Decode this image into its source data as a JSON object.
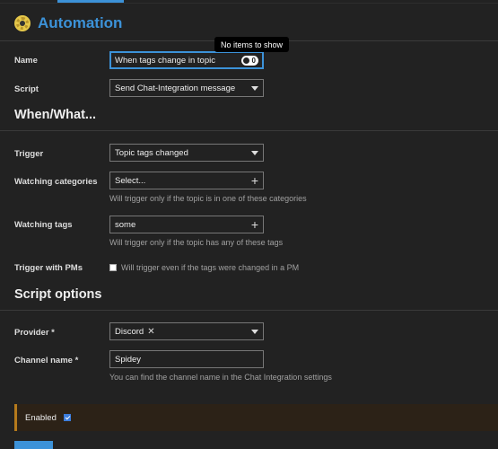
{
  "header": {
    "title": "Automation",
    "icon": "gear-icon"
  },
  "tooltip": "No items to show",
  "form": {
    "name": {
      "label": "Name",
      "value": "When tags change in topic"
    },
    "script": {
      "label": "Script",
      "value": "Send Chat-Integration message"
    }
  },
  "when_section": {
    "title": "When/What...",
    "trigger": {
      "label": "Trigger",
      "value": "Topic tags changed"
    },
    "watching_categories": {
      "label": "Watching categories",
      "value": "Select...",
      "help": "Will trigger only if the topic is in one of these categories"
    },
    "watching_tags": {
      "label": "Watching tags",
      "value": "some",
      "help": "Will trigger only if the topic has any of these tags"
    },
    "trigger_pms": {
      "label": "Trigger with PMs",
      "help": "Will trigger even if the tags were changed in a PM",
      "checked": false
    }
  },
  "script_options": {
    "title": "Script options",
    "provider": {
      "label": "Provider *",
      "value": "Discord"
    },
    "channel_name": {
      "label": "Channel name *",
      "value": "Spidey",
      "help": "You can find the channel name in the Chat Integration settings"
    }
  },
  "enabled": {
    "label": "Enabled",
    "checked": true
  },
  "colors": {
    "accent": "#3c92d8",
    "background": "#222222",
    "warning": "#b57a1c"
  }
}
